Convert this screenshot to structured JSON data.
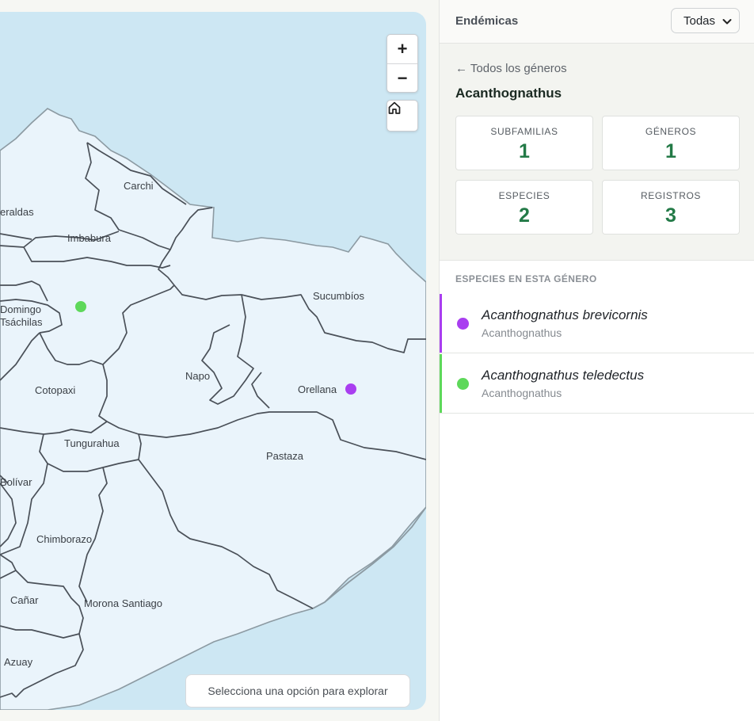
{
  "map": {
    "labels": {
      "esmeraldas": "eraldas",
      "carchi": "Carchi",
      "imbabura": "Imbabura",
      "sucumbios": "Sucumbíos",
      "santo_domingo_1": "Domingo",
      "santo_domingo_2": "Tsáchilas",
      "napo": "Napo",
      "orellana": "Orellana",
      "cotopaxi": "Cotopaxi",
      "tungurahua": "Tungurahua",
      "pastaza": "Pastaza",
      "bolivar": "Bolívar",
      "chimborazo": "Chimborazo",
      "canar": "Cañar",
      "morona_santiago": "Morona Santiago",
      "azuay": "Azuay"
    },
    "zoom_in_label": "+",
    "zoom_out_label": "−",
    "home_icon": "home-icon",
    "hint": "Selecciona una opción para explorar",
    "colors": {
      "water": "#cde7f3",
      "land": "#eaf4fb",
      "border": "#4a5058",
      "coast": "#8c9aa2"
    }
  },
  "header": {
    "title": "Endémicas",
    "select_value": "Todas"
  },
  "detail": {
    "back_label": "← Todos los géneros",
    "genus": "Acanthognathus",
    "stats": [
      {
        "label": "SUBFAMILIAS",
        "value": "1"
      },
      {
        "label": "GÉNEROS",
        "value": "1"
      },
      {
        "label": "ESPECIES",
        "value": "2"
      },
      {
        "label": "REGISTROS",
        "value": "3"
      }
    ]
  },
  "species_section": {
    "title": "ESPECIES EN ESTA GÉNERO",
    "items": [
      {
        "name": "Acanthognathus brevicornis",
        "genus": "Acanthognathus",
        "color": "#a93ef0"
      },
      {
        "name": "Acanthognathus teledectus",
        "genus": "Acanthognathus",
        "color": "#5ed85a"
      }
    ]
  }
}
